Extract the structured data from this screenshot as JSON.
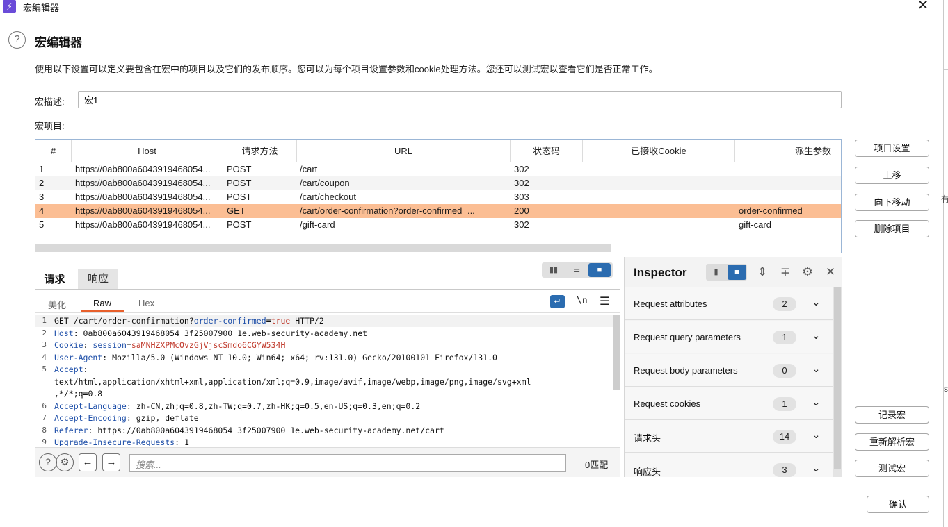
{
  "window": {
    "title": "宏编辑器",
    "app_icon": "lightning-icon"
  },
  "header": {
    "heading": "宏编辑器",
    "description": "使用以下设置可以定义要包含在宏中的项目以及它们的发布顺序。您可以为每个项目设置参数和cookie处理方法。您还可以测试宏以查看它们是否正常工作。"
  },
  "macro": {
    "desc_label": "宏描述:",
    "desc_value": "宏1",
    "items_label": "宏项目:"
  },
  "table": {
    "columns": [
      "#",
      "Host",
      "请求方法",
      "URL",
      "状态码",
      "已接收Cookie",
      "派生参数"
    ],
    "rows": [
      {
        "num": "1",
        "host": "https://0ab800a6043919468054...",
        "method": "POST",
        "url": "/cart",
        "status": "302",
        "cookie": "",
        "param": ""
      },
      {
        "num": "2",
        "host": "https://0ab800a6043919468054...",
        "method": "POST",
        "url": "/cart/coupon",
        "status": "302",
        "cookie": "",
        "param": ""
      },
      {
        "num": "3",
        "host": "https://0ab800a6043919468054...",
        "method": "POST",
        "url": "/cart/checkout",
        "status": "303",
        "cookie": "",
        "param": ""
      },
      {
        "num": "4",
        "host": "https://0ab800a6043919468054...",
        "method": "GET",
        "url": "/cart/order-confirmation?order-confirmed=...",
        "status": "200",
        "cookie": "",
        "param": "order-confirmed"
      },
      {
        "num": "5",
        "host": "https://0ab800a6043919468054...",
        "method": "POST",
        "url": "/gift-card",
        "status": "302",
        "cookie": "",
        "param": "gift-card"
      }
    ],
    "selected_row": 4
  },
  "side_buttons": {
    "item_settings": "项目设置",
    "move_up": "上移",
    "move_down": "向下移动",
    "delete_item": "删除项目",
    "record_macro": "记录宏",
    "reparse_macro": "重新解析宏",
    "test_macro": "测试宏",
    "ok": "确认"
  },
  "request_panel": {
    "tabs": [
      "请求",
      "响应"
    ],
    "active_tab": "请求",
    "subtabs": [
      "美化",
      "Raw",
      "Hex"
    ],
    "active_subtab": "Raw",
    "newline_toggle": "\\n",
    "lines": [
      {
        "n": "1",
        "parts": [
          [
            "",
            "GET /cart/order-confirmation?"
          ],
          [
            "k",
            "order-confirmed"
          ],
          [
            "",
            "="
          ],
          [
            "v",
            "true"
          ],
          [
            "",
            " HTTP/2"
          ]
        ]
      },
      {
        "n": "2",
        "parts": [
          [
            "k",
            "Host"
          ],
          [
            "",
            ": 0ab800a6043919468054 3f25007900 1e.web-security-academy.net"
          ]
        ]
      },
      {
        "n": "3",
        "parts": [
          [
            "k",
            "Cookie"
          ],
          [
            "",
            ": "
          ],
          [
            "k",
            "session"
          ],
          [
            "",
            "="
          ],
          [
            "v",
            "saMNHZXPMcOvzGjVjscSmdo6CGYW534H"
          ]
        ]
      },
      {
        "n": "4",
        "parts": [
          [
            "k",
            "User-Agent"
          ],
          [
            "",
            ": Mozilla/5.0 (Windows NT 10.0; Win64; x64; rv:131.0) Gecko/20100101 Firefox/131.0"
          ]
        ]
      },
      {
        "n": "5",
        "parts": [
          [
            "k",
            "Accept"
          ],
          [
            "",
            ":"
          ]
        ]
      },
      {
        "n": "",
        "parts": [
          [
            "",
            "text/html,application/xhtml+xml,application/xml;q=0.9,image/avif,image/webp,image/png,image/svg+xml"
          ]
        ]
      },
      {
        "n": "",
        "parts": [
          [
            "",
            ",*/*;q=0.8"
          ]
        ]
      },
      {
        "n": "6",
        "parts": [
          [
            "k",
            "Accept-Language"
          ],
          [
            "",
            ": zh-CN,zh;q=0.8,zh-TW;q=0.7,zh-HK;q=0.5,en-US;q=0.3,en;q=0.2"
          ]
        ]
      },
      {
        "n": "7",
        "parts": [
          [
            "k",
            "Accept-Encoding"
          ],
          [
            "",
            ": gzip, deflate"
          ]
        ]
      },
      {
        "n": "8",
        "parts": [
          [
            "k",
            "Referer"
          ],
          [
            "",
            ": https://0ab800a6043919468054 3f25007900 1e.web-security-academy.net/cart"
          ]
        ]
      },
      {
        "n": "9",
        "parts": [
          [
            "k",
            "Upgrade-Insecure-Requests"
          ],
          [
            "",
            ": 1"
          ]
        ]
      }
    ],
    "search_placeholder": "搜索...",
    "match_count": "0匹配"
  },
  "inspector": {
    "title": "Inspector",
    "rows": [
      {
        "label": "Request attributes",
        "count": "2"
      },
      {
        "label": "Request query parameters",
        "count": "1"
      },
      {
        "label": "Request body parameters",
        "count": "0"
      },
      {
        "label": "Request cookies",
        "count": "1"
      },
      {
        "label": "请求头",
        "count": "14"
      },
      {
        "label": "响应头",
        "count": "3"
      }
    ]
  },
  "colors": {
    "selected_row": "#fbbe94",
    "accent": "#2b6cb0",
    "tab_underline": "#e8602c",
    "header_name": "#1d4ea8",
    "value": "#c0392b"
  },
  "edge_fragments": [
    "有",
    "s"
  ]
}
